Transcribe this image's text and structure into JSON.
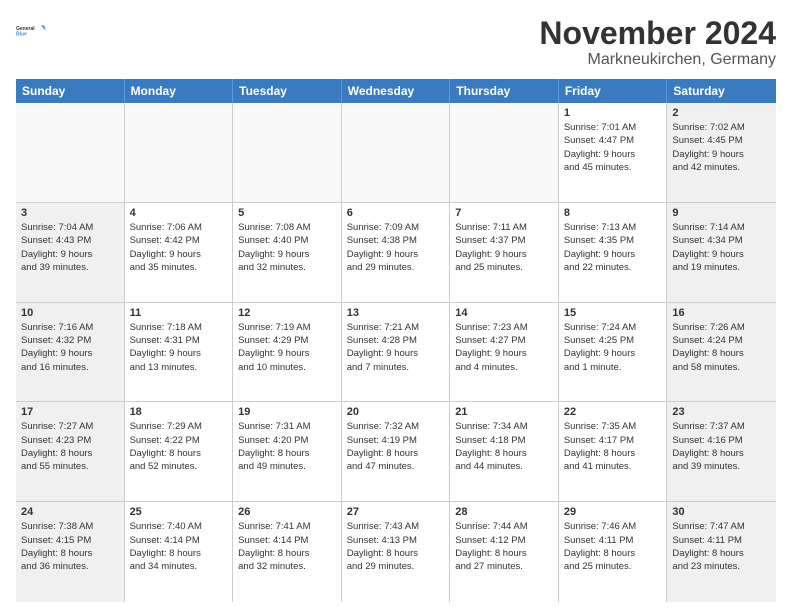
{
  "logo": {
    "line1": "General",
    "line2": "Blue"
  },
  "header": {
    "month": "November 2024",
    "location": "Markneukirchen, Germany"
  },
  "weekdays": [
    "Sunday",
    "Monday",
    "Tuesday",
    "Wednesday",
    "Thursday",
    "Friday",
    "Saturday"
  ],
  "weeks": [
    [
      {
        "day": "",
        "info": ""
      },
      {
        "day": "",
        "info": ""
      },
      {
        "day": "",
        "info": ""
      },
      {
        "day": "",
        "info": ""
      },
      {
        "day": "",
        "info": ""
      },
      {
        "day": "1",
        "info": "Sunrise: 7:01 AM\nSunset: 4:47 PM\nDaylight: 9 hours\nand 45 minutes."
      },
      {
        "day": "2",
        "info": "Sunrise: 7:02 AM\nSunset: 4:45 PM\nDaylight: 9 hours\nand 42 minutes."
      }
    ],
    [
      {
        "day": "3",
        "info": "Sunrise: 7:04 AM\nSunset: 4:43 PM\nDaylight: 9 hours\nand 39 minutes."
      },
      {
        "day": "4",
        "info": "Sunrise: 7:06 AM\nSunset: 4:42 PM\nDaylight: 9 hours\nand 35 minutes."
      },
      {
        "day": "5",
        "info": "Sunrise: 7:08 AM\nSunset: 4:40 PM\nDaylight: 9 hours\nand 32 minutes."
      },
      {
        "day": "6",
        "info": "Sunrise: 7:09 AM\nSunset: 4:38 PM\nDaylight: 9 hours\nand 29 minutes."
      },
      {
        "day": "7",
        "info": "Sunrise: 7:11 AM\nSunset: 4:37 PM\nDaylight: 9 hours\nand 25 minutes."
      },
      {
        "day": "8",
        "info": "Sunrise: 7:13 AM\nSunset: 4:35 PM\nDaylight: 9 hours\nand 22 minutes."
      },
      {
        "day": "9",
        "info": "Sunrise: 7:14 AM\nSunset: 4:34 PM\nDaylight: 9 hours\nand 19 minutes."
      }
    ],
    [
      {
        "day": "10",
        "info": "Sunrise: 7:16 AM\nSunset: 4:32 PM\nDaylight: 9 hours\nand 16 minutes."
      },
      {
        "day": "11",
        "info": "Sunrise: 7:18 AM\nSunset: 4:31 PM\nDaylight: 9 hours\nand 13 minutes."
      },
      {
        "day": "12",
        "info": "Sunrise: 7:19 AM\nSunset: 4:29 PM\nDaylight: 9 hours\nand 10 minutes."
      },
      {
        "day": "13",
        "info": "Sunrise: 7:21 AM\nSunset: 4:28 PM\nDaylight: 9 hours\nand 7 minutes."
      },
      {
        "day": "14",
        "info": "Sunrise: 7:23 AM\nSunset: 4:27 PM\nDaylight: 9 hours\nand 4 minutes."
      },
      {
        "day": "15",
        "info": "Sunrise: 7:24 AM\nSunset: 4:25 PM\nDaylight: 9 hours\nand 1 minute."
      },
      {
        "day": "16",
        "info": "Sunrise: 7:26 AM\nSunset: 4:24 PM\nDaylight: 8 hours\nand 58 minutes."
      }
    ],
    [
      {
        "day": "17",
        "info": "Sunrise: 7:27 AM\nSunset: 4:23 PM\nDaylight: 8 hours\nand 55 minutes."
      },
      {
        "day": "18",
        "info": "Sunrise: 7:29 AM\nSunset: 4:22 PM\nDaylight: 8 hours\nand 52 minutes."
      },
      {
        "day": "19",
        "info": "Sunrise: 7:31 AM\nSunset: 4:20 PM\nDaylight: 8 hours\nand 49 minutes."
      },
      {
        "day": "20",
        "info": "Sunrise: 7:32 AM\nSunset: 4:19 PM\nDaylight: 8 hours\nand 47 minutes."
      },
      {
        "day": "21",
        "info": "Sunrise: 7:34 AM\nSunset: 4:18 PM\nDaylight: 8 hours\nand 44 minutes."
      },
      {
        "day": "22",
        "info": "Sunrise: 7:35 AM\nSunset: 4:17 PM\nDaylight: 8 hours\nand 41 minutes."
      },
      {
        "day": "23",
        "info": "Sunrise: 7:37 AM\nSunset: 4:16 PM\nDaylight: 8 hours\nand 39 minutes."
      }
    ],
    [
      {
        "day": "24",
        "info": "Sunrise: 7:38 AM\nSunset: 4:15 PM\nDaylight: 8 hours\nand 36 minutes."
      },
      {
        "day": "25",
        "info": "Sunrise: 7:40 AM\nSunset: 4:14 PM\nDaylight: 8 hours\nand 34 minutes."
      },
      {
        "day": "26",
        "info": "Sunrise: 7:41 AM\nSunset: 4:14 PM\nDaylight: 8 hours\nand 32 minutes."
      },
      {
        "day": "27",
        "info": "Sunrise: 7:43 AM\nSunset: 4:13 PM\nDaylight: 8 hours\nand 29 minutes."
      },
      {
        "day": "28",
        "info": "Sunrise: 7:44 AM\nSunset: 4:12 PM\nDaylight: 8 hours\nand 27 minutes."
      },
      {
        "day": "29",
        "info": "Sunrise: 7:46 AM\nSunset: 4:11 PM\nDaylight: 8 hours\nand 25 minutes."
      },
      {
        "day": "30",
        "info": "Sunrise: 7:47 AM\nSunset: 4:11 PM\nDaylight: 8 hours\nand 23 minutes."
      }
    ]
  ]
}
